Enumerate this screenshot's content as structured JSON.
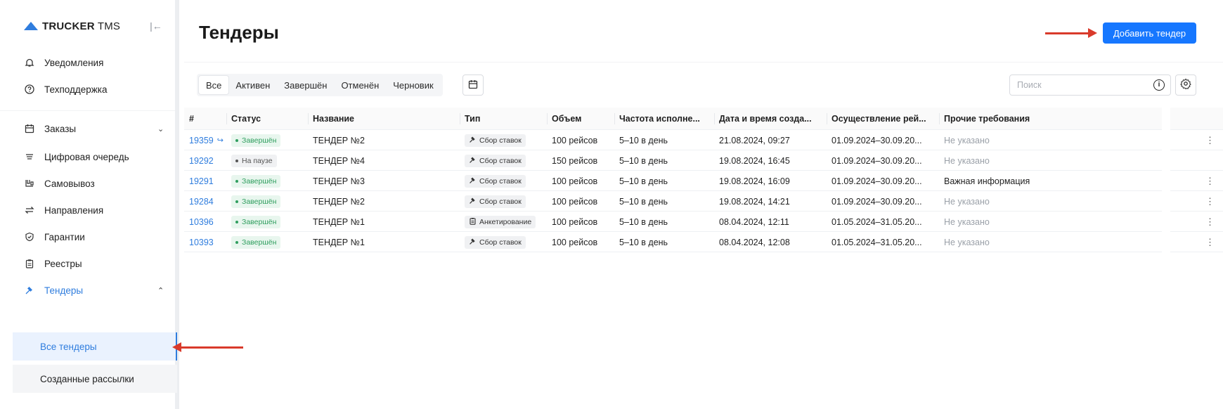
{
  "app": {
    "logo_bold": "TRUCKER",
    "logo_light": " TMS",
    "collapse_icon": "collapse-left-icon"
  },
  "sidebar": {
    "top_items": [
      {
        "label": "Уведомления",
        "icon": "bell-icon"
      },
      {
        "label": "Техподдержка",
        "icon": "help-circle-icon"
      }
    ],
    "items": [
      {
        "label": "Заказы",
        "icon": "calendar-icon",
        "chevron": "down"
      },
      {
        "label": "Цифровая очередь",
        "icon": "queue-icon"
      },
      {
        "label": "Самовывоз",
        "icon": "pickup-icon"
      },
      {
        "label": "Направления",
        "icon": "arrows-exchange-icon"
      },
      {
        "label": "Гарантии",
        "icon": "shield-check-icon"
      },
      {
        "label": "Реестры",
        "icon": "clipboard-icon"
      },
      {
        "label": "Тендеры",
        "icon": "gavel-icon",
        "chevron": "up",
        "active": true
      }
    ],
    "sub_items": [
      {
        "label": "Все тендеры",
        "active": true
      },
      {
        "label": "Созданные рассылки"
      }
    ]
  },
  "header": {
    "title": "Тендеры",
    "add_button": "Добавить тендер"
  },
  "filters": {
    "tabs": [
      "Все",
      "Активен",
      "Завершён",
      "Отменён",
      "Черновик"
    ],
    "active_tab": "Все",
    "search_placeholder": "Поиск"
  },
  "table": {
    "columns": [
      "#",
      "Статус",
      "Название",
      "Тип",
      "Объем",
      "Частота исполне...",
      "Дата и время созда...",
      "Осуществление рей...",
      "Прочие требования"
    ],
    "rows": [
      {
        "id": "19359",
        "linked": true,
        "status": "Завершён",
        "status_kind": "done",
        "name": "ТЕНДЕР №2",
        "type": "Сбор ставок",
        "type_icon": "gavel-icon",
        "volume": "100 рейсов",
        "frequency": "5–10 в день",
        "created": "21.08.2024, 09:27",
        "period": "01.09.2024–30.09.20...",
        "requirements": "Не указано",
        "req_muted": true,
        "menu": true
      },
      {
        "id": "19292",
        "linked": false,
        "status": "На паузе",
        "status_kind": "pause",
        "name": "ТЕНДЕР №4",
        "type": "Сбор ставок",
        "type_icon": "gavel-icon",
        "volume": "150 рейсов",
        "frequency": "5–10 в день",
        "created": "19.08.2024, 16:45",
        "period": "01.09.2024–30.09.20...",
        "requirements": "Не указано",
        "req_muted": true,
        "menu": false
      },
      {
        "id": "19291",
        "linked": false,
        "status": "Завершён",
        "status_kind": "done",
        "name": "ТЕНДЕР №3",
        "type": "Сбор ставок",
        "type_icon": "gavel-icon",
        "volume": "100 рейсов",
        "frequency": "5–10 в день",
        "created": "19.08.2024, 16:09",
        "period": "01.09.2024–30.09.20...",
        "requirements": "Важная информация",
        "req_muted": false,
        "menu": true
      },
      {
        "id": "19284",
        "linked": false,
        "status": "Завершён",
        "status_kind": "done",
        "name": "ТЕНДЕР №2",
        "type": "Сбор ставок",
        "type_icon": "gavel-icon",
        "volume": "100 рейсов",
        "frequency": "5–10 в день",
        "created": "19.08.2024, 14:21",
        "period": "01.09.2024–30.09.20...",
        "requirements": "Не указано",
        "req_muted": true,
        "menu": true
      },
      {
        "id": "10396",
        "linked": false,
        "status": "Завершён",
        "status_kind": "done",
        "name": "ТЕНДЕР №1",
        "type": "Анкетирование",
        "type_icon": "clipboard-icon",
        "volume": "100 рейсов",
        "frequency": "5–10 в день",
        "created": "08.04.2024, 12:11",
        "period": "01.05.2024–31.05.20...",
        "requirements": "Не указано",
        "req_muted": true,
        "menu": true
      },
      {
        "id": "10393",
        "linked": false,
        "status": "Завершён",
        "status_kind": "done",
        "name": "ТЕНДЕР №1",
        "type": "Сбор ставок",
        "type_icon": "gavel-icon",
        "volume": "100 рейсов",
        "frequency": "5–10 в день",
        "created": "08.04.2024, 12:08",
        "period": "01.05.2024–31.05.20...",
        "requirements": "Не указано",
        "req_muted": true,
        "menu": true
      }
    ]
  },
  "colors": {
    "accent": "#1677ff",
    "link": "#2f7dde",
    "done_badge": "#2f9e5e",
    "annotation_arrow": "#d93a2b"
  }
}
